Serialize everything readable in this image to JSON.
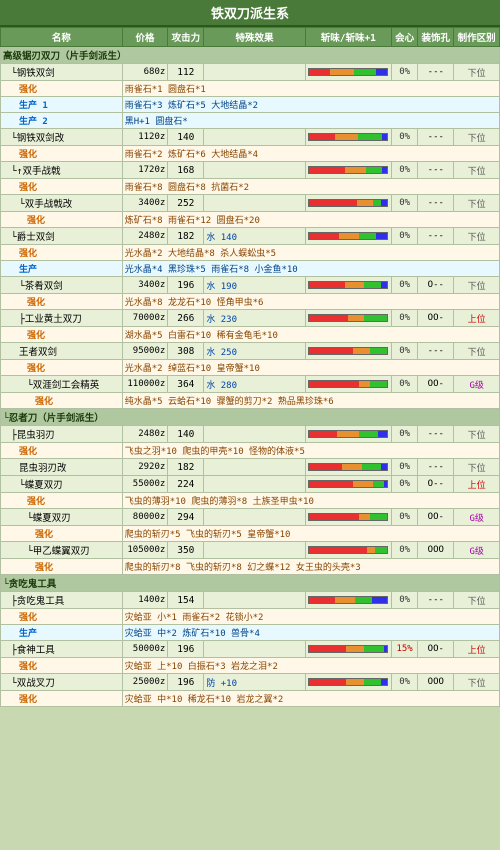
{
  "title": "铁双刀派生系",
  "headers": [
    "名称",
    "价格",
    "攻击力",
    "特殊效果",
    "斩味/斩味+1",
    "会心",
    "装饰孔",
    "制作区别"
  ],
  "rows": [
    {
      "type": "category",
      "name": "高级锯刃双刀（片手剑派生）",
      "indent": 0
    },
    {
      "type": "main",
      "name": "└钢铁双剑",
      "price": "680z",
      "atk": "112",
      "special": "",
      "bars": "rrrrrrrroooooooooggggggggbbbb",
      "heart": "0%",
      "craft": "---",
      "rank": "下位",
      "indent": 1
    },
    {
      "type": "enhance",
      "name": "强化",
      "special": "雨雀石*1 圆盘石*1",
      "indent": 2
    },
    {
      "type": "produce",
      "name": "生产 1",
      "special": "雨雀石*3 炼矿石*5 大地结晶*2",
      "indent": 2
    },
    {
      "type": "produce",
      "name": "生产 2",
      "special": "黑H+1 圆盘石*",
      "indent": 2
    },
    {
      "type": "main",
      "name": "└钢铁双剑改",
      "price": "1120z",
      "atk": "140",
      "special": "",
      "bars": "rrrrrrrrrrooooooooogggggggggbb",
      "heart": "0%",
      "craft": "---",
      "rank": "下位",
      "indent": 1
    },
    {
      "type": "enhance",
      "name": "强化",
      "special": "雨雀石*2 炼矿石*6 大地结晶*4",
      "indent": 2
    },
    {
      "type": "main",
      "name": "└↑双手战戟",
      "price": "1720z",
      "atk": "168",
      "special": "",
      "bars": "rrrrrrrrrrrrrrooooooooggggggbb",
      "heart": "0%",
      "craft": "---",
      "rank": "下位",
      "indent": 1
    },
    {
      "type": "enhance",
      "name": "强化",
      "special": "雨雀石*8 圆盘石*8 抗菌石*2",
      "indent": 2
    },
    {
      "type": "main",
      "name": "└双手战戟改",
      "price": "3400z",
      "atk": "252",
      "special": "",
      "bars": "rrrrrrrrrrrrrrrrrroooooogggbb",
      "heart": "0%",
      "craft": "---",
      "rank": "下位",
      "indent": 2
    },
    {
      "type": "enhance",
      "name": "强化",
      "special": "炼矿石*8 雨雀石*12 圆盘石*20",
      "indent": 3
    },
    {
      "type": "main",
      "name": "└爵士双剑",
      "price": "2480z",
      "atk": "182",
      "special": "水 140",
      "bars": "rrrrrrrrrrroooooooggggggbbbb",
      "heart": "0%",
      "craft": "---",
      "rank": "下位",
      "indent": 1
    },
    {
      "type": "enhance",
      "name": "强化",
      "special": "光水晶*2 大地结晶*8 杀人蜈蚣虫*5",
      "indent": 2
    },
    {
      "type": "produce",
      "name": "生产",
      "special": "光水晶*4 黑珍珠*5 雨雀石*8 小金鱼*10",
      "indent": 2
    },
    {
      "type": "main",
      "name": "└茶肴双剑",
      "price": "3400z",
      "atk": "196",
      "special": "水 190",
      "bars": "rrrrrrrrrrrrroooooooggggggbb",
      "heart": "0%",
      "craft": "O--",
      "rank": "下位",
      "indent": 2
    },
    {
      "type": "enhance",
      "name": "强化",
      "special": "光水晶*8 龙龙石*10 怪角甲虫*6",
      "indent": 3
    },
    {
      "type": "main",
      "name": "├工业黄土双刀",
      "price": "70000z",
      "atk": "266",
      "special": "水 230",
      "bars": "rrrrrrrrrrrrrroooooogggggggg",
      "heart": "0%",
      "craft": "OO-",
      "rank": "上位",
      "indent": 2
    },
    {
      "type": "enhance",
      "name": "强化",
      "special": "湖水晶*5 白雷石*10 稀有金龟毛*10",
      "indent": 3
    },
    {
      "type": "main",
      "name": "王者双剑",
      "price": "95000z",
      "atk": "308",
      "special": "水 250",
      "bars": "rrrrrrrrrrrrrrrroooooogggggg",
      "heart": "0%",
      "craft": "---",
      "rank": "下位",
      "indent": 2
    },
    {
      "type": "enhance",
      "name": "强化",
      "special": "光水晶*2 绰蓝石*10 皇帝蟹*10",
      "indent": 3
    },
    {
      "type": "main",
      "name": "└双涯剑工会精英",
      "price": "110000z",
      "atk": "364",
      "special": "水 280",
      "bars": "rrrrrrrrrrrrrrrrrroooogggggg",
      "heart": "0%",
      "craft": "OO-",
      "rank": "G级",
      "indent": 3
    },
    {
      "type": "enhance",
      "name": "强化",
      "special": "纯水晶*5 云蛤石*10 骤蟹的剪刀*2 熟品黑珍珠*6",
      "indent": 4
    },
    {
      "type": "category",
      "name": "└忍者刀（片手剑派生）",
      "indent": 0
    },
    {
      "type": "main",
      "name": "├昆虫羽刃",
      "price": "2480z",
      "atk": "140",
      "special": "",
      "bars": "rrrrrrrrrroooooooogggggggbbb",
      "heart": "0%",
      "craft": "---",
      "rank": "下位",
      "indent": 1
    },
    {
      "type": "enhance",
      "name": "强化",
      "special": "飞虫之羽*10 爬虫的甲壳*10 怪物的体液*5",
      "indent": 2
    },
    {
      "type": "main",
      "name": "昆虫羽刃改",
      "price": "2920z",
      "atk": "182",
      "special": "",
      "bars": "rrrrrrrrrrrrooooooogggggggbb",
      "heart": "0%",
      "craft": "---",
      "rank": "下位",
      "indent": 2
    },
    {
      "type": "main",
      "name": "└蝶夏双刃",
      "price": "55000z",
      "atk": "224",
      "special": "",
      "bars": "rrrrrrrrrrrrrrrroooooooggggb",
      "heart": "0%",
      "craft": "O--",
      "rank": "上位",
      "indent": 2
    },
    {
      "type": "enhance",
      "name": "强化",
      "special": "飞虫的薄羽*10 爬虫的薄羽*8 土族圣甲虫*10",
      "indent": 3
    },
    {
      "type": "main",
      "name": "└蝶夏双刃",
      "price": "80000z",
      "atk": "294",
      "special": "",
      "bars": "rrrrrrrrrrrrrrrrrroooogggggg",
      "heart": "0%",
      "craft": "OO-",
      "rank": "G级",
      "indent": 3
    },
    {
      "type": "enhance",
      "name": "强化",
      "special": "爬虫的斩刃*5 飞虫的斩刃*5 皇帝蟹*10",
      "indent": 4
    },
    {
      "type": "main",
      "name": "└甲乙蝶翼双刃",
      "price": "105000z",
      "atk": "350",
      "special": "",
      "bars": "rrrrrrrrrrrrrrrrrrrrooogggg",
      "heart": "0%",
      "craft": "OOO",
      "rank": "G级",
      "indent": 3
    },
    {
      "type": "enhance",
      "name": "强化",
      "special": "爬虫的斩刃*8 飞虫的斩刃*8 幻之蝶*12 女王虫的头壳*3",
      "indent": 4
    },
    {
      "type": "category",
      "name": "└贪吃鬼工具",
      "indent": 0
    },
    {
      "type": "main",
      "name": "├贪吃鬼工具",
      "price": "1400z",
      "atk": "154",
      "special": "",
      "bars": "rrrrrrrrroooooooggggggbbbbb",
      "heart": "0%",
      "craft": "---",
      "rank": "下位",
      "indent": 1
    },
    {
      "type": "enhance",
      "name": "强化",
      "special": "灾蛤亚 小*1 雨雀石*2 花锁小*2",
      "indent": 2
    },
    {
      "type": "produce",
      "name": "生产",
      "special": "灾蛤亚 中*2 炼矿石*10 兽骨*4",
      "indent": 2
    },
    {
      "type": "main",
      "name": "├食神工具",
      "price": "50000z",
      "atk": "196",
      "special": "",
      "bars": "rrrrrrrrrrrrroooooogggggggb",
      "heart": "15%",
      "craft": "OO-",
      "rank": "上位",
      "indent": 1
    },
    {
      "type": "enhance",
      "name": "强化",
      "special": "灾蛤亚 上*10 白振石*3 岩龙之泪*2",
      "indent": 2
    },
    {
      "type": "main",
      "name": "└双战叉刀",
      "price": "25000z",
      "atk": "196",
      "special": "防 +10",
      "bars": "rrrrrrrrrrrrrooooooggggggbb",
      "heart": "0%",
      "craft": "OOO",
      "rank": "下位",
      "indent": 1
    },
    {
      "type": "enhance",
      "name": "强化",
      "special": "灾蛤亚 中*10 稀龙石*10 岩龙之翼*2",
      "indent": 2
    }
  ]
}
